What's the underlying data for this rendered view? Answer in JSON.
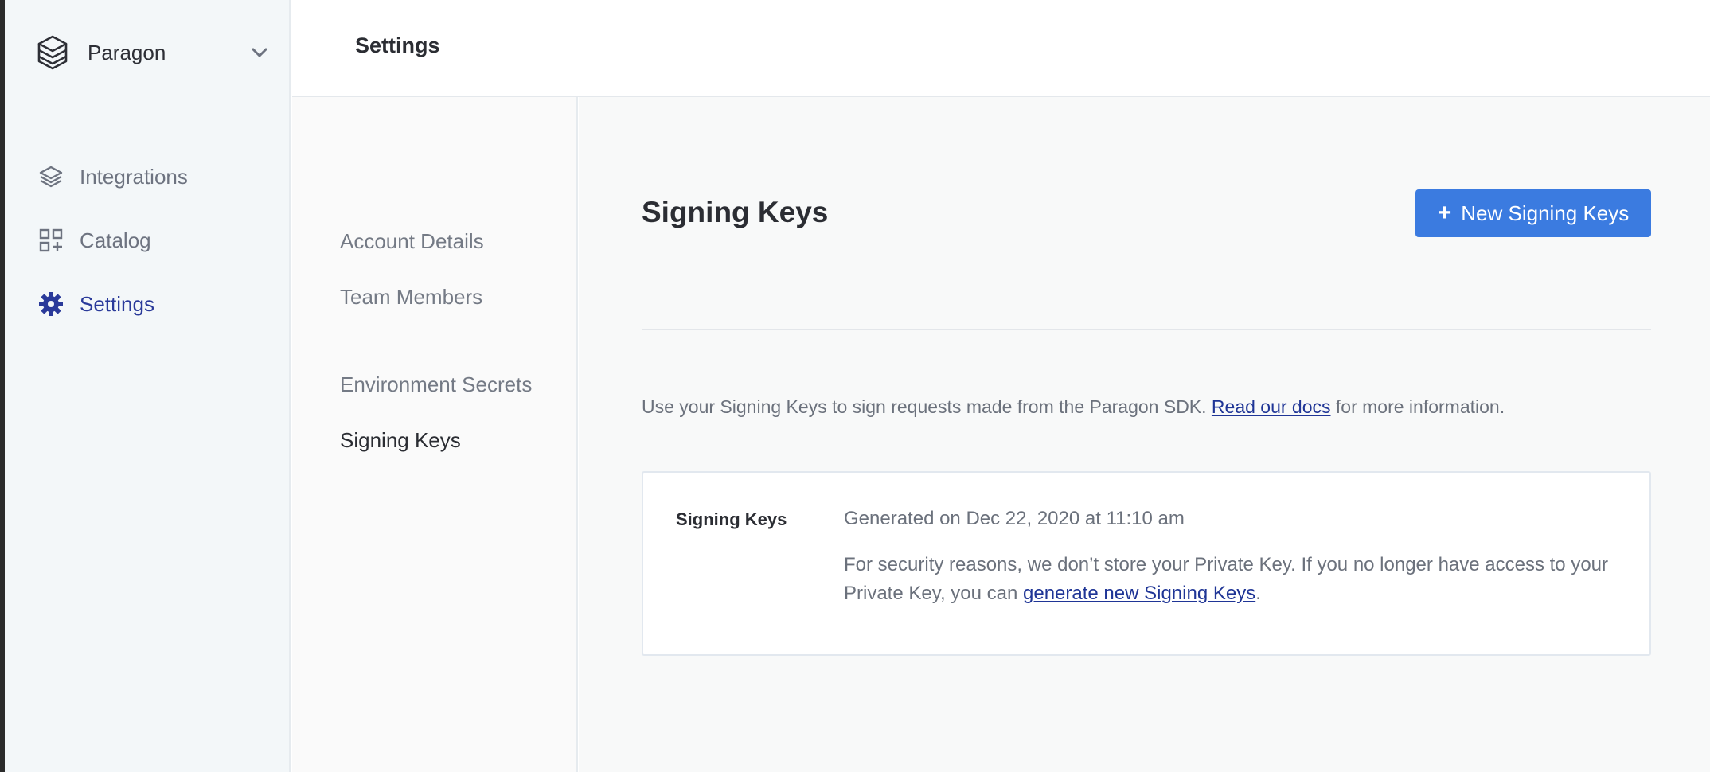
{
  "workspace": {
    "name": "Paragon",
    "logo_icon": "stacked-layers-logo-icon",
    "dropdown_icon": "chevron-down-icon"
  },
  "sidebar": {
    "items": [
      {
        "label": "Integrations",
        "icon": "layers-icon",
        "active": false
      },
      {
        "label": "Catalog",
        "icon": "grid-plus-icon",
        "active": false
      },
      {
        "label": "Settings",
        "icon": "gear-icon",
        "active": true
      }
    ]
  },
  "header": {
    "title": "Settings"
  },
  "subnav": {
    "items": [
      {
        "label": "Account Details",
        "active": false
      },
      {
        "label": "Team Members",
        "active": false
      },
      {
        "label": "Environment Secrets",
        "active": false
      },
      {
        "label": "Signing Keys",
        "active": true
      }
    ]
  },
  "main": {
    "heading": "Signing Keys",
    "new_button_label": "New Signing Keys",
    "description": {
      "before": "Use your Signing Keys to sign requests made from the Paragon SDK. ",
      "link": "Read our docs",
      "after": " for more information."
    },
    "card": {
      "label": "Signing Keys",
      "generated": "Generated on Dec 22, 2020 at 11:10 am",
      "note_before": "For security reasons, we don’t store your Private Key. If you no longer have access to your Private Key, you can ",
      "note_link": "generate new Signing Keys",
      "note_after": "."
    }
  },
  "colors": {
    "accent": "#3b7be0",
    "active_nav": "#2a3a9a",
    "link": "#1f3596"
  }
}
